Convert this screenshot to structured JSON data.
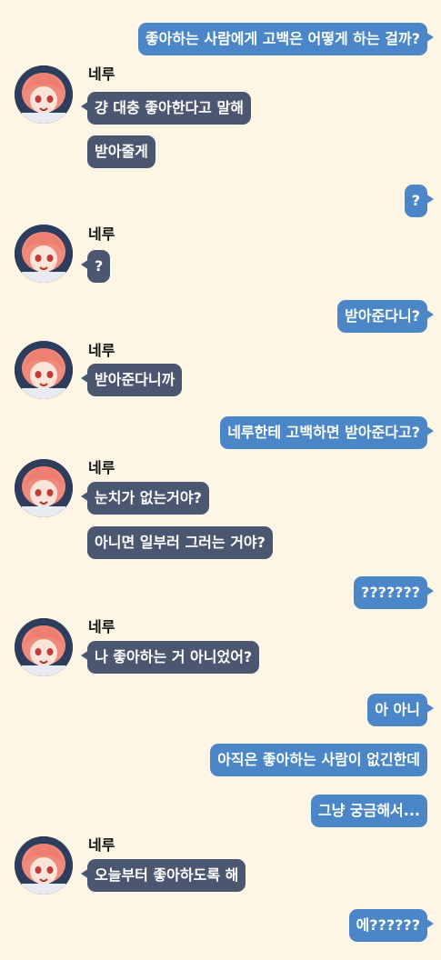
{
  "bot_name": "네루",
  "messages": [
    {
      "text": "좋아하는 사람에게 고백은 어떻게 하는 걸까?"
    },
    {
      "text": "걍 대충 좋아한다고 말해"
    },
    {
      "text": "받아줄게"
    },
    {
      "text": "?"
    },
    {
      "text": "?"
    },
    {
      "text": "받아준다니?"
    },
    {
      "text": "받아준다니까"
    },
    {
      "text": "네루한테 고백하면 받아준다고?"
    },
    {
      "text": "눈치가 없는거야?"
    },
    {
      "text": "아니면 일부러 그러는 거야?"
    },
    {
      "text": "???????"
    },
    {
      "text": "나 좋아하는 거 아니었어?"
    },
    {
      "text": "아 아니"
    },
    {
      "text": "아직은 좋아하는 사람이 없긴한데"
    },
    {
      "text": "그냥 궁금해서..."
    },
    {
      "text": "오늘부터 좋아하도록 해"
    },
    {
      "text": "에??????"
    }
  ],
  "colors": {
    "background": "#fef6e4",
    "user_bubble": "#4a86c8",
    "bot_bubble": "#4b5770"
  }
}
